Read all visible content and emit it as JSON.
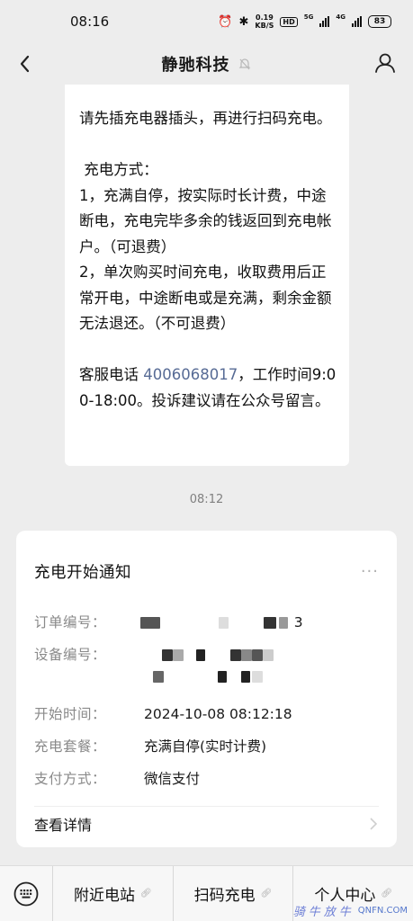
{
  "status_bar": {
    "time": "08:16",
    "speed_value": "0.19",
    "speed_unit": "KB/S",
    "hd_badge": "HD",
    "signal1_label": "5G",
    "signal2_label": "4G",
    "battery": "83"
  },
  "nav": {
    "title": "静驰科技"
  },
  "message": {
    "text_before_phone": "请先插充电器插头，再进行扫码充电。\n\n 充电方式：\n1，充满自停，按实际时长计费，中途断电，充电完毕多余的钱返回到充电帐户。（可退费）\n2，单次购买时间充电，收取费用后正常开电，中途断电或是充满，剩余金额无法退还。（不可退费）\n\n客服电话 ",
    "phone": "4006068017",
    "text_after_phone": "，工作时间9:00-18:00。投诉建议请在公众号留言。"
  },
  "time_separator": "08:12",
  "card": {
    "title": "充电开始通知",
    "more": "···",
    "rows": [
      {
        "label": "订单编号：",
        "value": "3"
      },
      {
        "label": "设备编号：",
        "value": ""
      },
      {
        "label": "开始时间：",
        "value": "2024-10-08 08:12:18"
      },
      {
        "label": "充电套餐：",
        "value": "充满自停(实时计费)"
      },
      {
        "label": "支付方式：",
        "value": "微信支付"
      }
    ],
    "details_label": "查看详情"
  },
  "bottom_menu": {
    "items": [
      {
        "label": "附近电站"
      },
      {
        "label": "扫码充电"
      },
      {
        "label": "个人中心"
      }
    ]
  },
  "watermark": {
    "cn": "骑牛放牛",
    "url": "QNFN.COM"
  },
  "colors": {
    "background": "#ededed",
    "link": "#576b95",
    "label_gray": "#8a8a8a"
  },
  "icons": [
    "alarm-icon",
    "bluetooth-icon",
    "back-arrow-icon",
    "mute-bell-icon",
    "user-icon",
    "chevron-right-icon",
    "keyboard-icon",
    "link-icon"
  ]
}
